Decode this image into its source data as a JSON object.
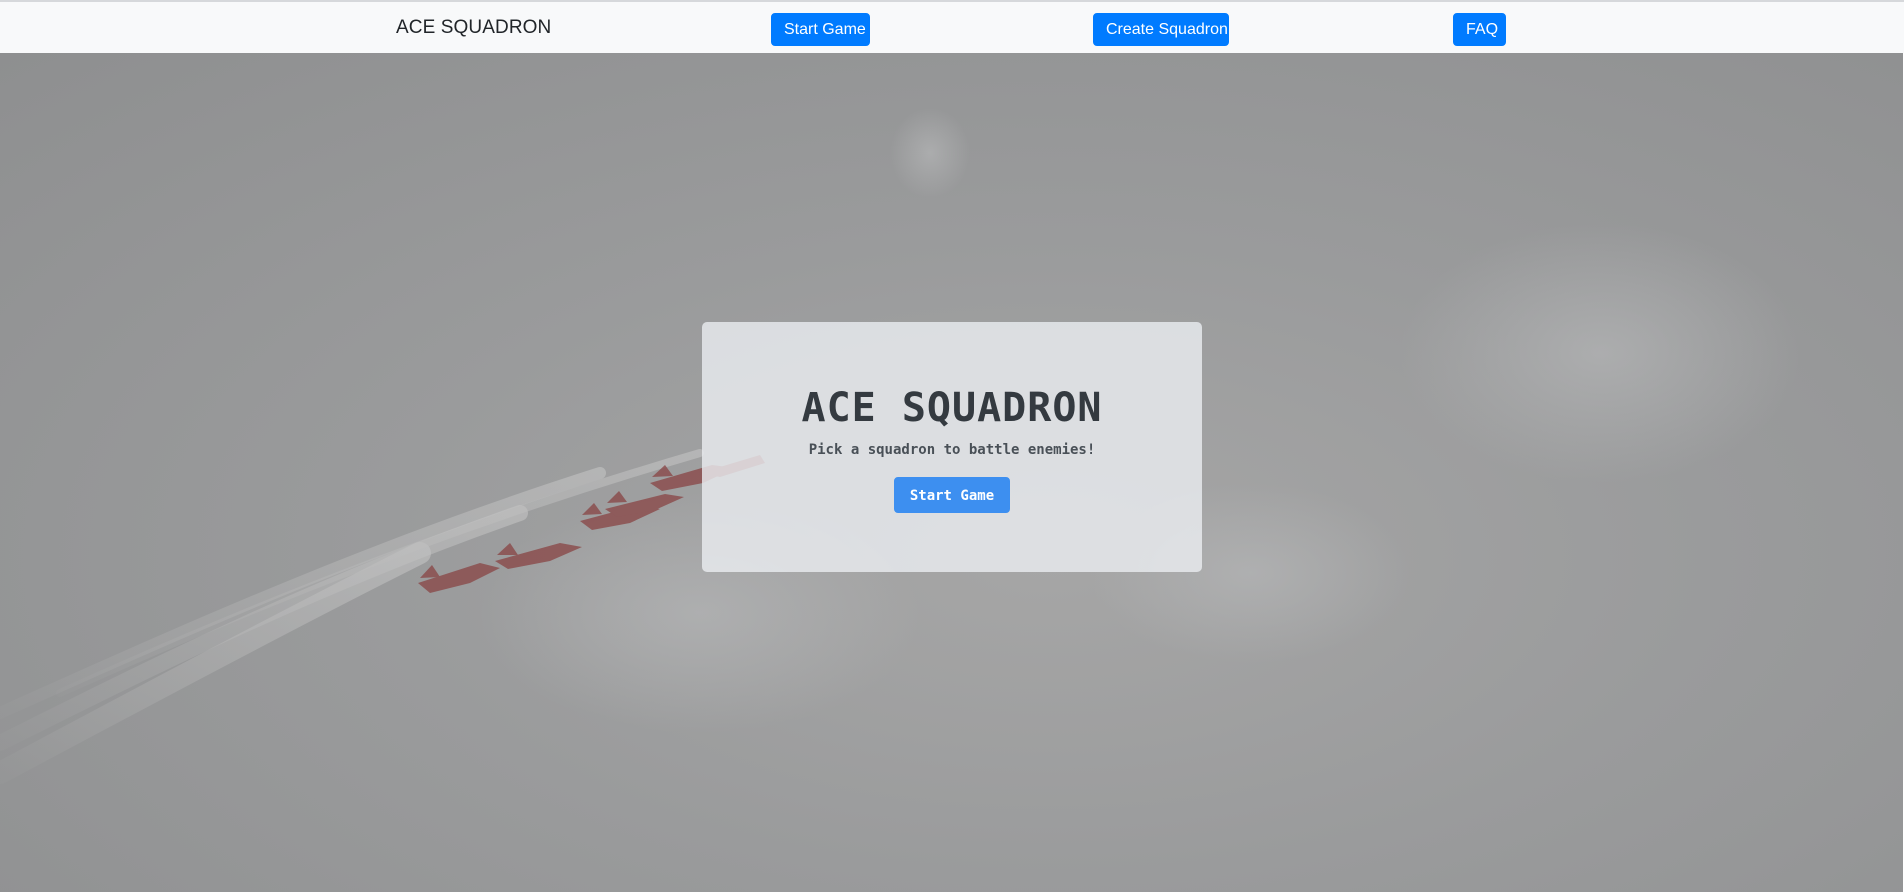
{
  "navbar": {
    "brand": "ACE SQUADRON",
    "buttons": [
      {
        "label": "Start Game"
      },
      {
        "label": "Create Squadron"
      },
      {
        "label": "FAQ"
      }
    ]
  },
  "hero": {
    "background_image": "aerobatic-jets-formation",
    "card": {
      "title": "ACE SQUADRON",
      "subtitle": "Pick a squadron to battle enemies!",
      "button_label": "Start Game"
    }
  },
  "colors": {
    "primary_button": "#007bff",
    "card_button": "#3d8ff0",
    "navbar_bg": "#f8f9fa",
    "title_text": "#343a40"
  }
}
